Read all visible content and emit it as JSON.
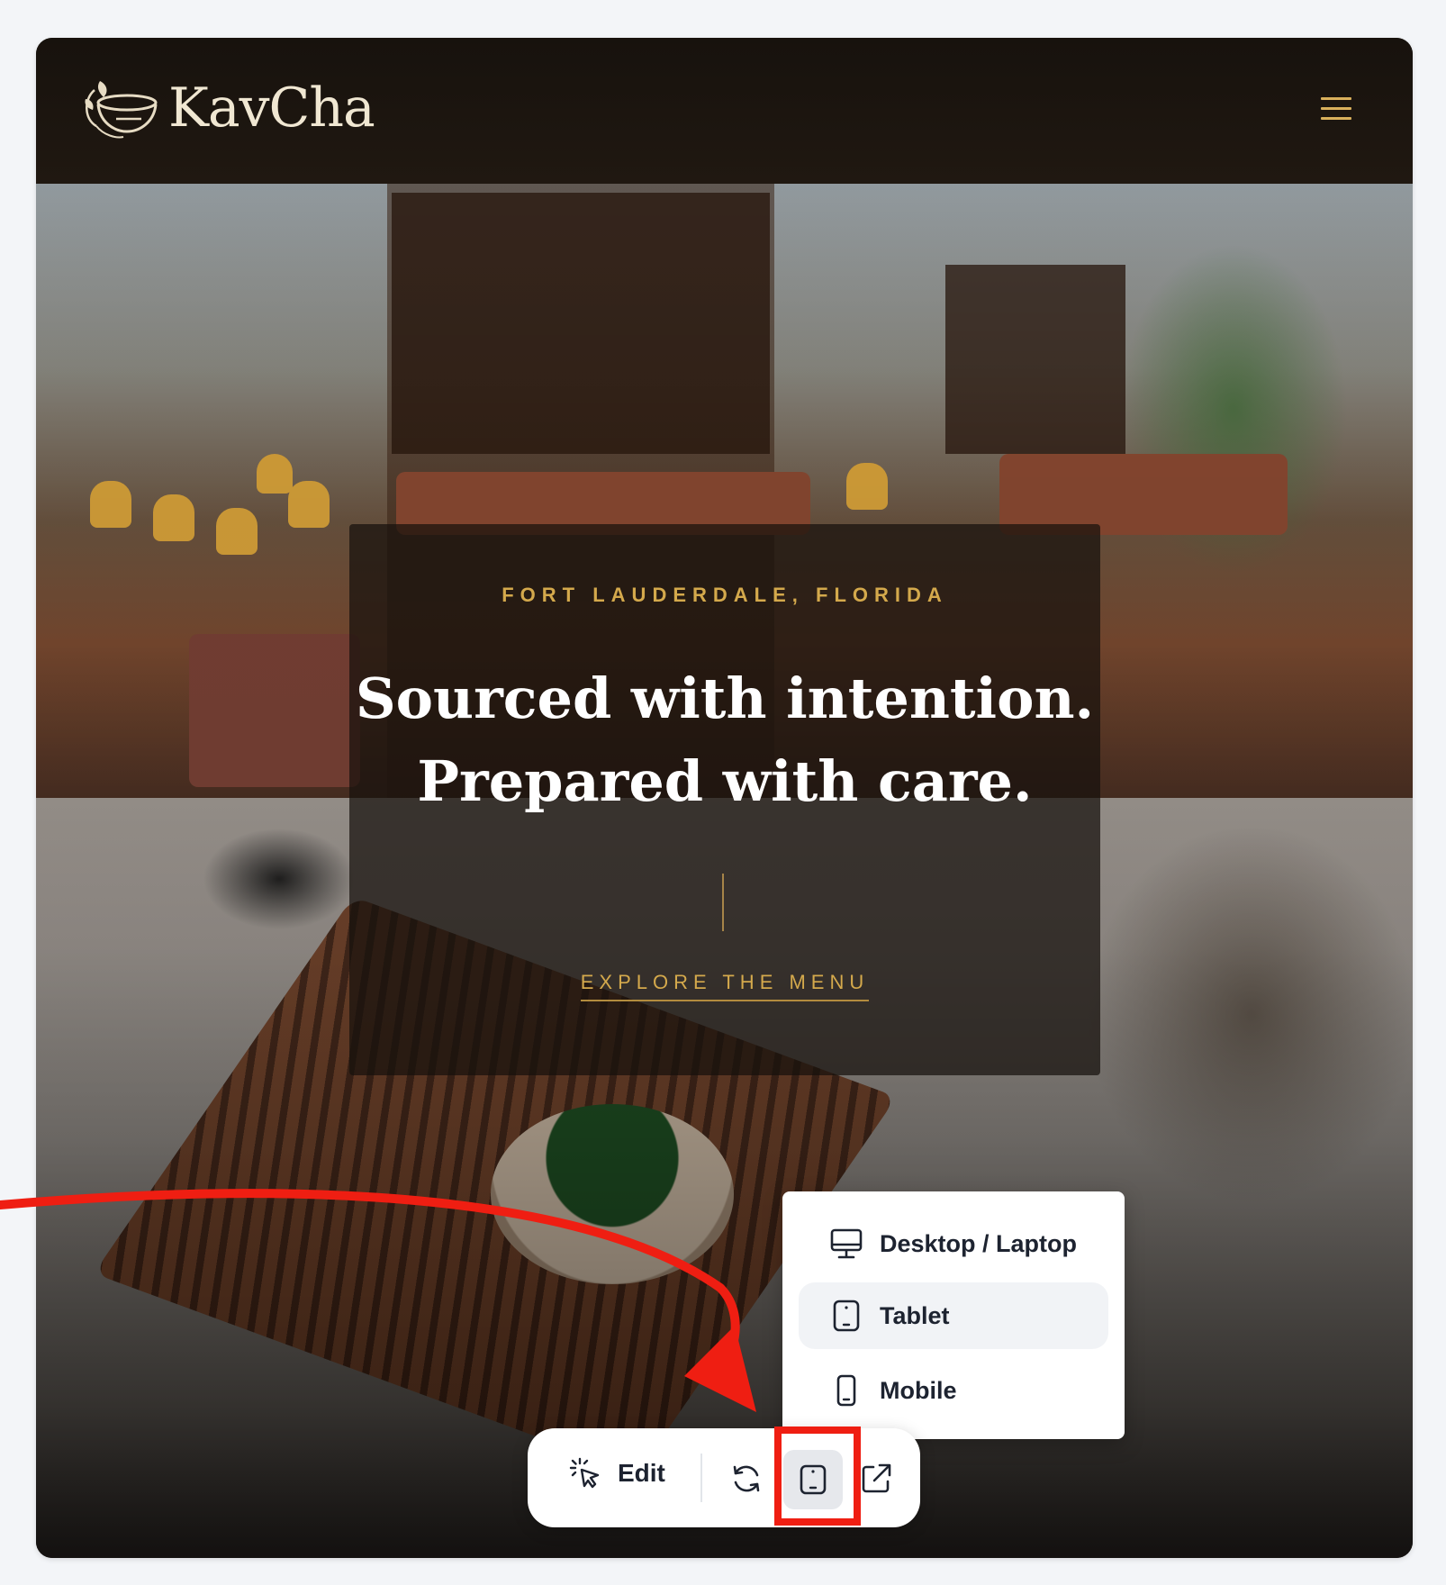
{
  "site": {
    "brand": "KavCha",
    "hero": {
      "eyebrow": "FORT LAUDERDALE, FLORIDA",
      "title_line1": "Sourced with intention.",
      "title_line2": "Prepared with care.",
      "cta": "EXPLORE THE MENU"
    }
  },
  "device_menu": {
    "items": [
      {
        "label": "Desktop / Laptop",
        "icon": "monitor-icon",
        "selected": false
      },
      {
        "label": "Tablet",
        "icon": "tablet-icon",
        "selected": true
      },
      {
        "label": "Mobile",
        "icon": "mobile-icon",
        "selected": false
      }
    ]
  },
  "toolbar": {
    "edit_label": "Edit",
    "icons": [
      "edit-cursor-icon",
      "refresh-icon",
      "tablet-icon",
      "open-external-icon"
    ]
  },
  "colors": {
    "accent_gold": "#d4a94c",
    "annotation_red": "#ef1e12",
    "header_bg": "#17120d"
  }
}
